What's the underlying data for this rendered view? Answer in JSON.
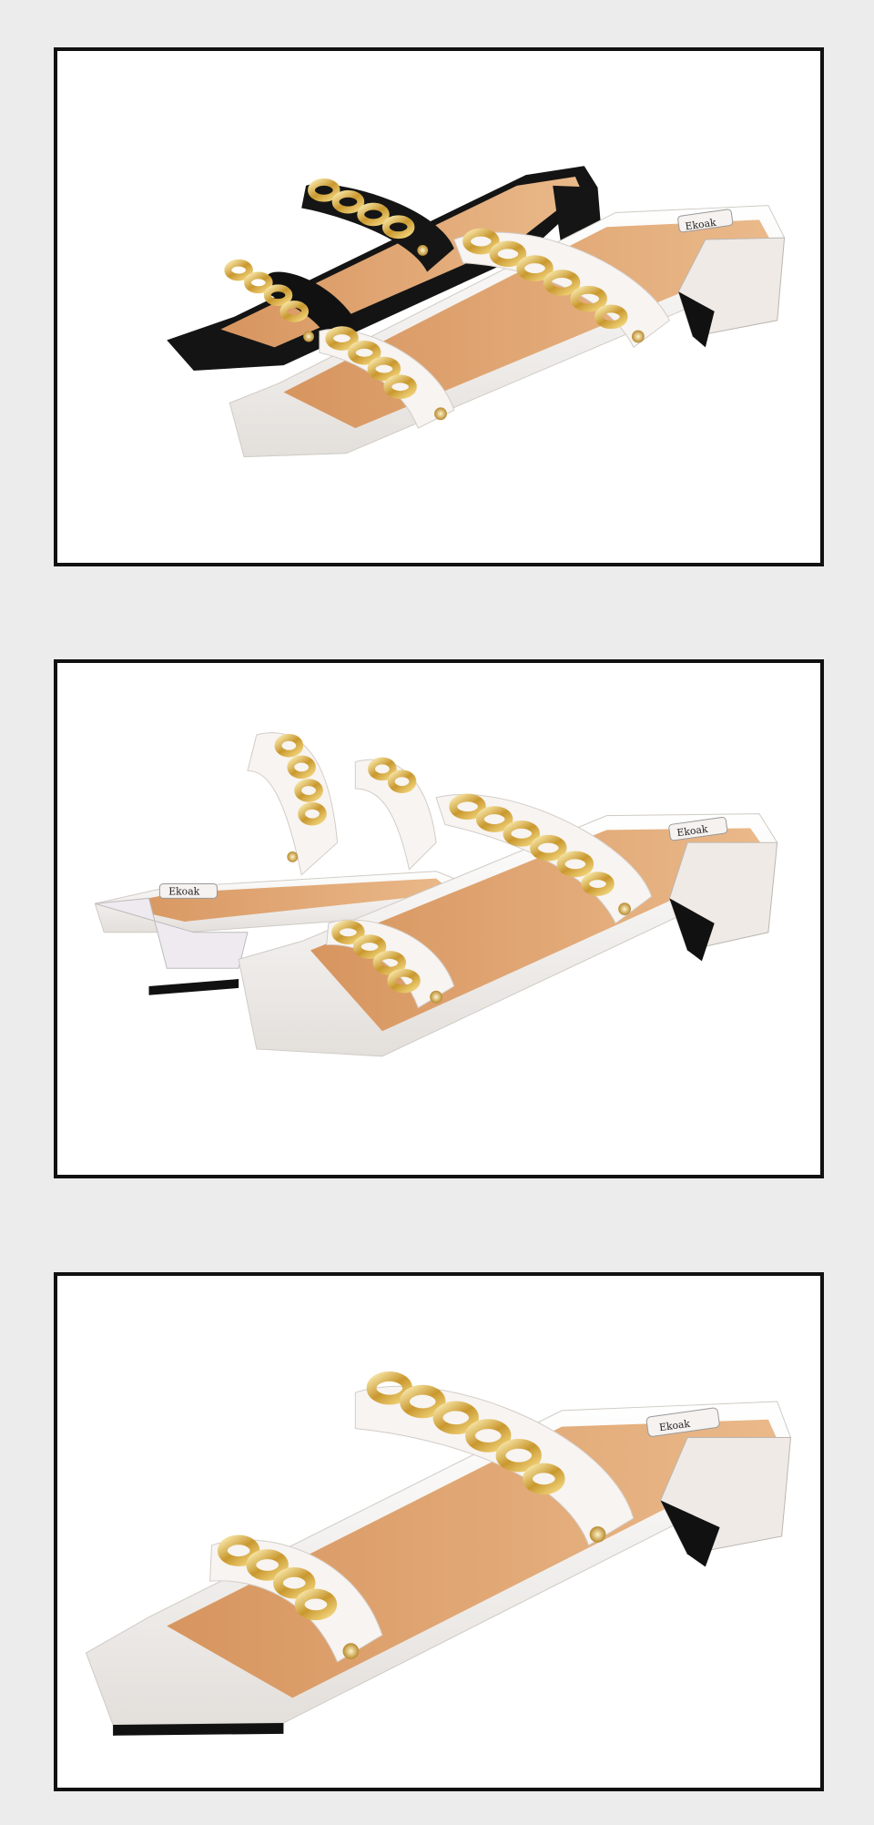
{
  "photos": [
    {
      "product": "chain-strap-slide-sandals",
      "colors": [
        "black",
        "white"
      ],
      "view": "pair-front"
    },
    {
      "product": "chain-strap-slide-sandals",
      "colors": [
        "white"
      ],
      "view": "pair-side"
    },
    {
      "product": "chain-strap-slide-sandals",
      "colors": [
        "white"
      ],
      "view": "single-closeup"
    }
  ],
  "brand_label": "Ekoak",
  "palette": {
    "page_bg": "#ececed",
    "frame_border": "#111111",
    "leather_white": "#f2efec",
    "leather_black": "#111111",
    "insole_tan": "#e0a978",
    "chain_gold": "#d8b25a"
  }
}
